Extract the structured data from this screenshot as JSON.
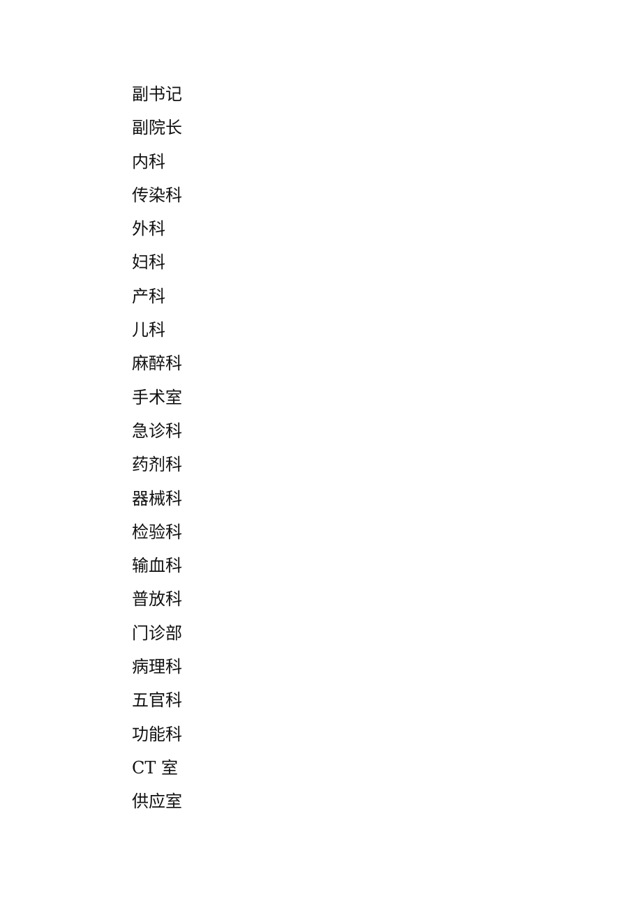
{
  "document": {
    "items": [
      "副书记",
      "副院长",
      "内科",
      "传染科",
      "外科",
      "妇科",
      "产科",
      "儿科",
      "麻醉科",
      "手术室",
      "急诊科",
      "药剂科",
      "器械科",
      "检验科",
      "输血科",
      "普放科",
      "门诊部",
      "病理科",
      "五官科",
      "功能科",
      "CT 室",
      "供应室"
    ]
  }
}
